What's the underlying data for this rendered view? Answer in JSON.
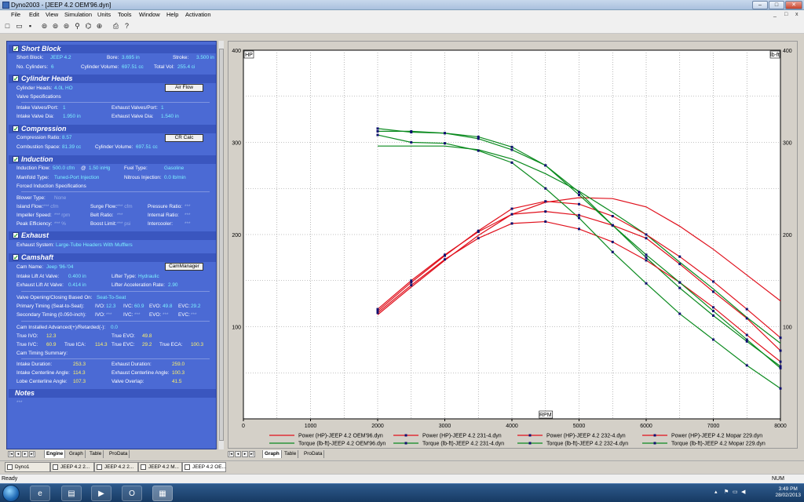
{
  "window": {
    "title": "Dyno2003 - [JEEP 4.2 OEM'96.dyn]",
    "min": "–",
    "max": "□",
    "close": "✕"
  },
  "menu": [
    "File",
    "Edit",
    "View",
    "Simulation",
    "Units",
    "Tools",
    "Window",
    "Help",
    "Activation"
  ],
  "menu_right": [
    "_",
    "□",
    "x"
  ],
  "toolbar_icons": [
    "new-icon",
    "open-icon",
    "save-icon",
    "engine-icon",
    "engine2-icon",
    "engine3-icon",
    "engine4-icon",
    "pump-icon",
    "cam-icon",
    "ignition-icon",
    "print-icon",
    "help-icon"
  ],
  "short_block": {
    "title": "Short Block",
    "short_block_label": "Short Block:",
    "short_block_value": "JEEP 4.2",
    "bore_label": "Bore:",
    "bore_value": "3.695 in",
    "stroke_label": "Stroke:",
    "stroke_value": "3.500 in",
    "cylinders_label": "No. Cylinders:",
    "cylinders_value": "6",
    "cyl_volume_label": "Cylinder Volume:",
    "cyl_volume_value": "697.51 cc",
    "total_vol_label": "Total Vol:",
    "total_vol_value": "255.4 ci"
  },
  "cylinder_heads": {
    "title": "Cylinder Heads",
    "heads_label": "Cylinder Heads:",
    "heads_value": "4.0L HO",
    "air_flow_button": "Air Flow",
    "valve_spec_label": "Valve Specifications",
    "intake_valves_label": "Intake Valves/Port:",
    "intake_valves_value": "1",
    "exhaust_valves_label": "Exhaust Valves/Port:",
    "exhaust_valves_value": "1",
    "intake_dia_label": "Intake Valve Dia:",
    "intake_dia_value": "1.950 in",
    "exhaust_dia_label": "Exhaust Valve Dia:",
    "exhaust_dia_value": "1.540 in"
  },
  "compression": {
    "title": "Compression",
    "ratio_label": "Compression Ratio:",
    "ratio_value": "8.57",
    "cr_calc_button": "CR Calc",
    "combustion_label": "Combustion Space:",
    "combustion_value": "81.39 cc",
    "cyl_volume_label": "Cylinder Volume:",
    "cyl_volume_value": "697.51 cc"
  },
  "induction": {
    "title": "Induction",
    "flow_label": "Induction Flow:",
    "flow_value": "500.0 cfm",
    "at_label": "@",
    "at_value": "1.50 inHg",
    "fuel_label": "Fuel Type:",
    "fuel_value": "Gasoline",
    "manifold_label": "Manifold Type:",
    "manifold_value": "Tuned-Port Injection",
    "nitrous_label": "Nitrous Injection:",
    "nitrous_value": "0.0 lb/min",
    "forced_label": "Forced Induction Specifications",
    "blower_label": "Blower Type:",
    "blower_value": "None",
    "island_label": "Island Flow:",
    "island_value": "*** cfm",
    "surge_label": "Surge Flow:",
    "surge_value": "*** cfm",
    "pressure_label": "Pressure Ratio:",
    "pressure_value": "***",
    "impeller_label": "Impeller Speed:",
    "impeller_value": "*** rpm",
    "belt_label": "Belt Ratio:",
    "belt_value": "***",
    "internal_label": "Internal Ratio:",
    "internal_value": "***",
    "peak_label": "Peak Efficiency:",
    "peak_value": "*** %",
    "boost_label": "Boost Limit:",
    "boost_value": "*** psi",
    "intercooler_label": "Intercooler:",
    "intercooler_value": "***"
  },
  "exhaust": {
    "title": "Exhaust",
    "system_label": "Exhaust System:",
    "system_value": "Large-Tube Headers With Mufflers"
  },
  "camshaft": {
    "title": "Camshaft",
    "cam_name_label": "Cam Name:",
    "cam_name_value": "Jeep '96-'04",
    "cam_manager_button": "CamManager",
    "intake_lift_label": "Intake Lift At Valve:",
    "intake_lift_value": "0.400 in",
    "lifter_type_label": "Lifter Type:",
    "lifter_type_value": "Hydraulic",
    "exhaust_lift_label": "Exhaust Lift At Valve:",
    "exhaust_lift_value": "0.414 in",
    "lifter_accel_label": "Lifter Acceleration Rate:",
    "lifter_accel_value": "2.90",
    "vo_label": "Valve Opening/Closing Based On:",
    "vo_value": "Seat-To-Seat",
    "primary_label": "Primary Timing (Seat-to-Seat):",
    "p_ivo_label": "IVO:",
    "p_ivo_value": "12.3",
    "p_ivc_label": "IVC:",
    "p_ivc_value": "60.9",
    "p_evo_label": "EVO:",
    "p_evo_value": "49.8",
    "p_evc_label": "EVC:",
    "p_evc_value": "29.2",
    "secondary_label": "Secondary Timing (0.050-inch):",
    "s_ivo_label": "IVO:",
    "s_ivo_value": "***",
    "s_ivc_label": "IVC:",
    "s_ivc_value": "***",
    "s_evo_label": "EVO:",
    "s_evo_value": "***",
    "s_evc_label": "EVC:",
    "s_evc_value": "***",
    "advanced_label": "Cam Installed Advanced(+)/Retarded(-):",
    "advanced_value": "0.0",
    "true_ivo_label": "True IVO:",
    "true_ivo_value": "12.3",
    "true_evo_label": "True EVO:",
    "true_evo_value": "49.8",
    "true_ivc_label": "True IVC:",
    "true_ivc_value": "60.9",
    "true_ica_label": "True ICA:",
    "true_ica_value": "114.3",
    "true_evc_label": "True EVC:",
    "true_evc_value": "29.2",
    "true_eca_label": "True ECA:",
    "true_eca_value": "100.3",
    "summary_label": "Cam Timing Summary:",
    "intake_duration_label": "Intake Duration:",
    "intake_duration_value": "253.3",
    "exhaust_duration_label": "Exhaust Duration:",
    "exhaust_duration_value": "259.0",
    "intake_cl_label": "Intake Centerline Angle:",
    "intake_cl_value": "114.3",
    "exhaust_cl_label": "Exhaust Centerline Angle:",
    "exhaust_cl_value": "100.3",
    "lobe_cl_label": "Lobe Centerline Angle:",
    "lobe_cl_value": "107.3",
    "overlap_label": "Valve Overlap:",
    "overlap_value": "41.5"
  },
  "notes": {
    "title": "Notes",
    "value": "***"
  },
  "left_tabs": [
    "Engine",
    "Graph",
    "Table",
    "ProData"
  ],
  "right_tabs": [
    "Graph",
    "Table",
    "ProData"
  ],
  "mdi_windows": [
    "Dyno1",
    "JEEP 4.2 2...",
    "JEEP 4.2 2...",
    "JEEP 4.2 M...",
    "JEEP 4.2 OE..."
  ],
  "status": {
    "left": "Ready",
    "right": "NUM"
  },
  "clock": {
    "time": "3:49 PM",
    "date": "28/02/2013"
  },
  "taskbar_apps": [
    "ie-icon",
    "folder-icon",
    "media-icon",
    "office-icon",
    "dyno-icon"
  ],
  "chart_data": {
    "type": "line",
    "xlabel": "RPM",
    "ylabel_left": "HP",
    "ylabel_right": "lb-ft",
    "xlim": [
      0,
      8000
    ],
    "ylim": [
      0,
      400
    ],
    "xticks": [
      0,
      1000,
      2000,
      3000,
      4000,
      5000,
      6000,
      7000,
      8000
    ],
    "yticks": [
      100,
      200,
      300,
      400
    ],
    "grid": true,
    "legend": "bottom",
    "colors": {
      "red": "#e0101c",
      "green": "#0a8a1e",
      "marker": "#101070"
    },
    "series": [
      {
        "name": "Power (HP)-JEEP 4.2 OEM'96.dyn",
        "color": "#e0101c",
        "markers": false,
        "x": [
          2000,
          2500,
          3000,
          3500,
          4000,
          4500,
          5000,
          5500,
          6000,
          6500,
          7000,
          7500,
          8000
        ],
        "y": [
          113,
          143,
          172,
          199,
          222,
          235,
          240,
          239,
          230,
          209,
          184,
          156,
          128
        ]
      },
      {
        "name": "Torque (lb-ft)-JEEP 4.2 OEM'96.dyn",
        "color": "#0a8a1e",
        "markers": false,
        "x": [
          2000,
          2500,
          3000,
          3500,
          4000,
          4500,
          5000,
          5500,
          6000,
          6500,
          7000,
          7500,
          8000
        ],
        "y": [
          296,
          296,
          296,
          292,
          282,
          266,
          247,
          224,
          200,
          170,
          141,
          110,
          82
        ]
      },
      {
        "name": "Power (HP)-JEEP 4.2 231-4.dyn",
        "color": "#e0101c",
        "markers": true,
        "x": [
          2000,
          2500,
          3000,
          3500,
          4000,
          4500,
          5000,
          5500,
          6000,
          6500,
          7000,
          7500,
          8000
        ],
        "y": [
          117,
          148,
          177,
          204,
          228,
          236,
          233,
          220,
          200,
          176,
          149,
          119,
          88
        ]
      },
      {
        "name": "Torque (lb-ft)-JEEP 4.2 231-4.dyn",
        "color": "#0a8a1e",
        "markers": true,
        "x": [
          2000,
          2500,
          3000,
          3500,
          4000,
          4500,
          5000,
          5500,
          6000,
          6500,
          7000,
          7500,
          8000
        ],
        "y": [
          315,
          311,
          310,
          306,
          295,
          275,
          246,
          210,
          175,
          142,
          112,
          84,
          57
        ]
      },
      {
        "name": "Power (HP)-JEEP 4.2 232-4.dyn",
        "color": "#e0101c",
        "markers": true,
        "x": [
          2000,
          2500,
          3000,
          3500,
          4000,
          4500,
          5000,
          5500,
          6000,
          6500,
          7000,
          7500,
          8000
        ],
        "y": [
          115,
          145,
          173,
          196,
          212,
          214,
          206,
          192,
          172,
          148,
          121,
          91,
          62
        ]
      },
      {
        "name": "Torque (lb-ft)-JEEP 4.2 232-4.dyn",
        "color": "#0a8a1e",
        "markers": true,
        "x": [
          2000,
          2500,
          3000,
          3500,
          4000,
          4500,
          5000,
          5500,
          6000,
          6500,
          7000,
          7500,
          8000
        ],
        "y": [
          308,
          300,
          299,
          291,
          278,
          250,
          218,
          181,
          147,
          114,
          86,
          58,
          33
        ]
      },
      {
        "name": "Power (HP)-JEEP 4.2 Mopar 229.dyn",
        "color": "#e0101c",
        "markers": true,
        "x": [
          2000,
          2500,
          3000,
          3500,
          4000,
          4500,
          5000,
          5500,
          6000,
          6500,
          7000,
          7500,
          8000
        ],
        "y": [
          119,
          150,
          178,
          203,
          222,
          225,
          221,
          210,
          196,
          168,
          138,
          109,
          74
        ]
      },
      {
        "name": "Torque (lb-ft)-JEEP 4.2 Mopar 229.dyn",
        "color": "#0a8a1e",
        "markers": true,
        "x": [
          2000,
          2500,
          3000,
          3500,
          4000,
          4500,
          5000,
          5500,
          6000,
          6500,
          7000,
          7500,
          8000
        ],
        "y": [
          312,
          312,
          310,
          304,
          292,
          275,
          243,
          210,
          178,
          148,
          117,
          86,
          55
        ]
      }
    ]
  }
}
